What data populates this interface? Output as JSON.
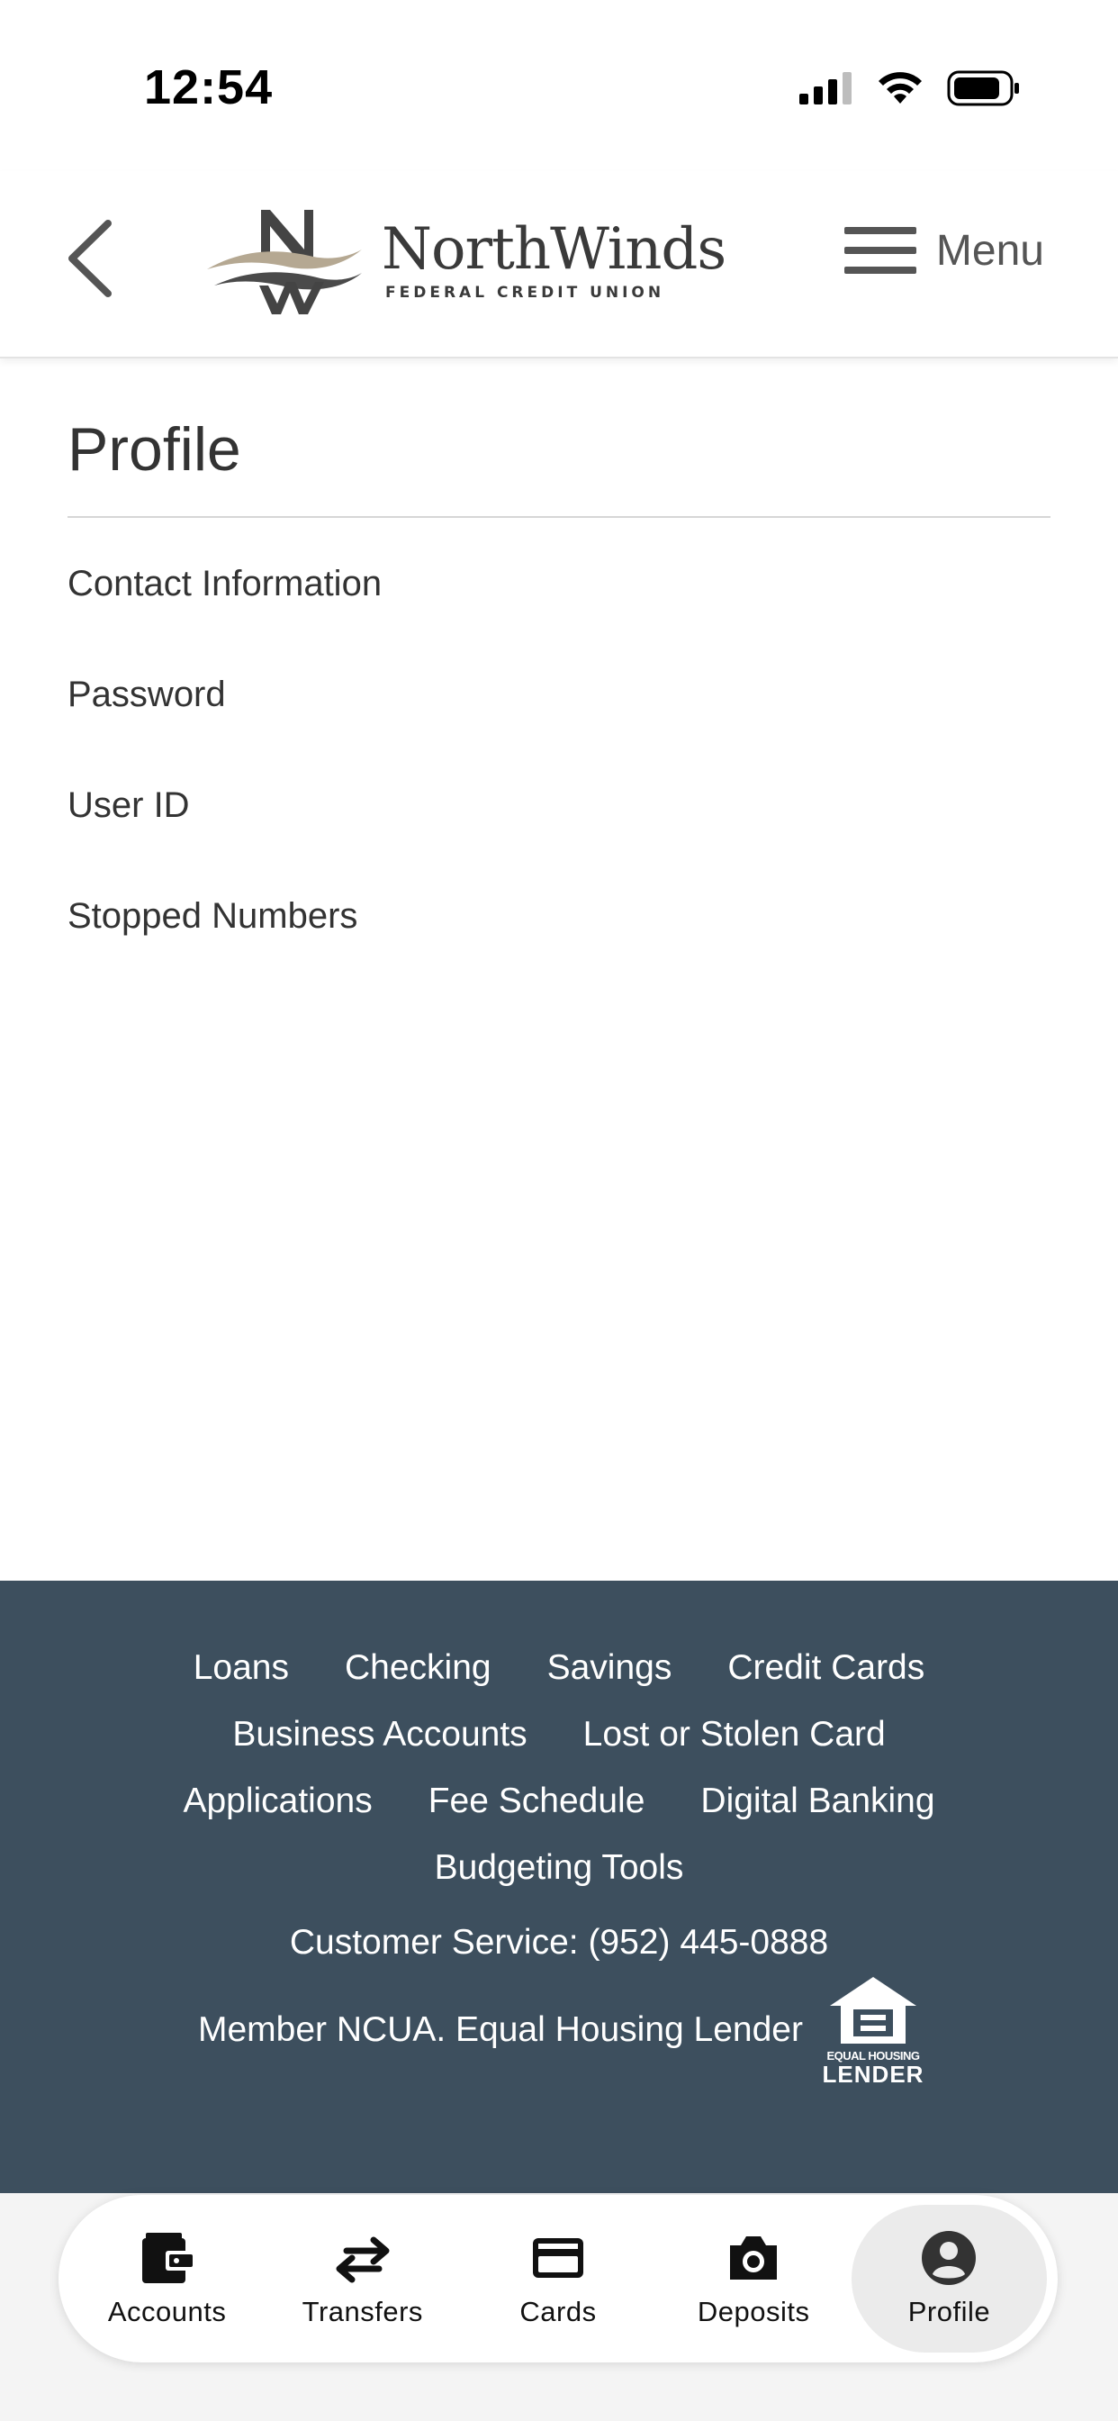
{
  "status_bar": {
    "time": "12:54"
  },
  "header": {
    "logo_name": "NorthWinds",
    "logo_subtitle": "FEDERAL CREDIT UNION",
    "menu_label": "Menu"
  },
  "page": {
    "title": "Profile",
    "items": [
      {
        "label": "Contact Information"
      },
      {
        "label": "Password"
      },
      {
        "label": "User ID"
      },
      {
        "label": "Stopped Numbers"
      }
    ]
  },
  "footer": {
    "links": [
      [
        "Loans",
        "Checking",
        "Savings",
        "Credit Cards"
      ],
      [
        "Business Accounts",
        "Lost or Stolen Card"
      ],
      [
        "Applications",
        "Fee Schedule",
        "Digital Banking"
      ],
      [
        "Budgeting Tools"
      ]
    ],
    "customer_service": "Customer Service: (952) 445-0888",
    "member_text": "Member NCUA. Equal Housing Lender",
    "ehl_small": "EQUAL HOUSING",
    "ehl_big": "LENDER"
  },
  "tab_bar": {
    "tabs": [
      {
        "label": "Accounts",
        "icon": "wallet-icon"
      },
      {
        "label": "Transfers",
        "icon": "transfer-arrows-icon"
      },
      {
        "label": "Cards",
        "icon": "credit-card-icon"
      },
      {
        "label": "Deposits",
        "icon": "camera-icon"
      },
      {
        "label": "Profile",
        "icon": "user-circle-icon"
      }
    ],
    "active": "Profile"
  },
  "colors": {
    "footer_bg": "#3d4f5e",
    "text": "#333333",
    "logo_accent": "#b5a892"
  }
}
